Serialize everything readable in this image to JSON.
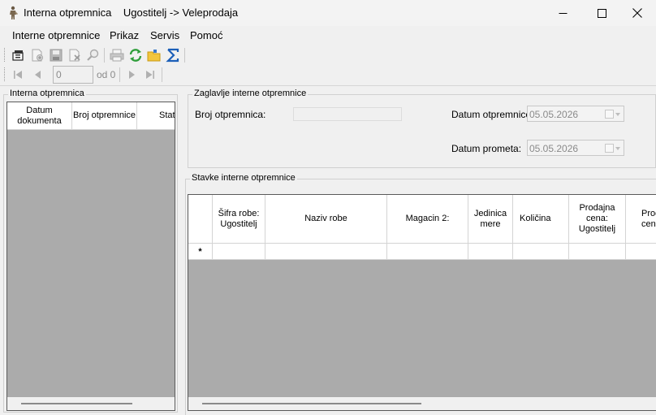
{
  "window": {
    "title": "Interna otpremnica    Ugostitelj -> Veleprodaja",
    "controls": [
      "minimize",
      "maximize",
      "close"
    ]
  },
  "menu": {
    "items": [
      "Interne otpremnice",
      "Prikaz",
      "Servis",
      "Pomoć"
    ]
  },
  "toolbar": {
    "buttons": [
      "new-document-icon",
      "add-item-icon",
      "save-icon",
      "delete-icon",
      "search-icon",
      "print-icon",
      "refresh-icon",
      "open-folder-icon",
      "sum-icon"
    ]
  },
  "navigator": {
    "position_value": "0",
    "of_label": "od 0"
  },
  "left_panel": {
    "title": "Interna otpremnica",
    "columns": [
      "Datum dokumenta",
      "Broj otpremnice",
      "Status"
    ]
  },
  "header_group": {
    "title": "Zaglavlje interne otpremnice",
    "broj_label": "Broj otpremnica:",
    "broj_value": "",
    "datum_otpremnice_label": "Datum otpremnice:",
    "datum_otpremnice_value": "05.05.2026",
    "datum_prometa_label": "Datum prometa:",
    "datum_prometa_value": "05.05.2026"
  },
  "items_group": {
    "title": "Stavke interne otpremnice",
    "columns": [
      "Šifra robe: Ugostitelj",
      "Naziv robe",
      "Magacin 2:",
      "Jedinica mere",
      "Količina",
      "Prodajna cena: Ugostitelj",
      "Prodajna cena"
    ],
    "new_row_marker": "*"
  }
}
